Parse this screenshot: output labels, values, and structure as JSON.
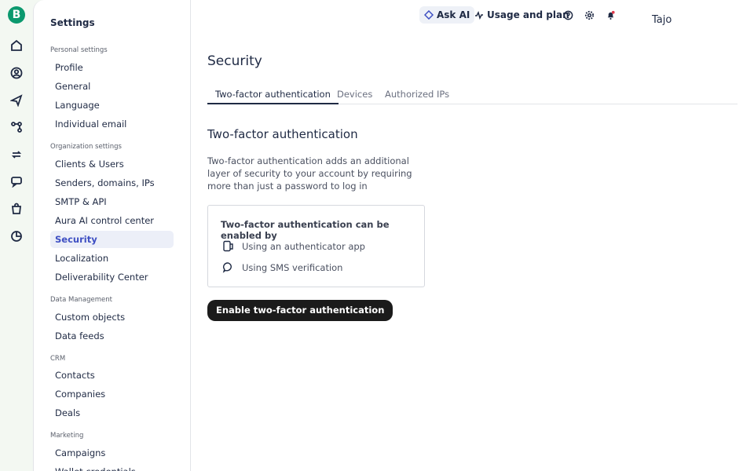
{
  "rail": {
    "logo": "B"
  },
  "sidebar": {
    "title": "Settings",
    "sections": [
      {
        "label": "Personal settings"
      },
      {
        "label": "Organization settings"
      },
      {
        "label": "Data Management"
      },
      {
        "label": "CRM"
      },
      {
        "label": "Marketing"
      }
    ],
    "items": [
      {
        "label": "Profile"
      },
      {
        "label": "General"
      },
      {
        "label": "Language"
      },
      {
        "label": "Individual email"
      },
      {
        "label": "Clients & Users"
      },
      {
        "label": "Senders, domains, IPs"
      },
      {
        "label": "SMTP & API"
      },
      {
        "label": "Aura AI control center"
      },
      {
        "label": "Security"
      },
      {
        "label": "Localization"
      },
      {
        "label": "Deliverability Center"
      },
      {
        "label": "Custom objects"
      },
      {
        "label": "Data feeds"
      },
      {
        "label": "Contacts"
      },
      {
        "label": "Companies"
      },
      {
        "label": "Deals"
      },
      {
        "label": "Campaigns"
      },
      {
        "label": "Wallet credentials"
      }
    ]
  },
  "topbar": {
    "ask_ai": "Ask AI",
    "usage": "Usage and plan",
    "user_name": "Tajo"
  },
  "main": {
    "title": "Security",
    "tabs": [
      {
        "label": "Two-factor authentication"
      },
      {
        "label": "Devices"
      },
      {
        "label": "Authorized IPs"
      }
    ],
    "heading": "Two-factor authentication",
    "description": "Two-factor authentication adds an additional layer of security to your account by requiring more than just a password to log in",
    "card": {
      "title": "Two-factor authentication can be enabled by",
      "options": [
        {
          "label": "Using an authenticator app",
          "icon": "authenticator-icon"
        },
        {
          "label": "Using SMS verification",
          "icon": "chat-bubble-icon"
        }
      ]
    },
    "enable_button": "Enable two-factor authentication"
  },
  "colors": {
    "brand": "#0b996e",
    "active_item": "#3e4fc3",
    "button": "#1b1b1b"
  }
}
